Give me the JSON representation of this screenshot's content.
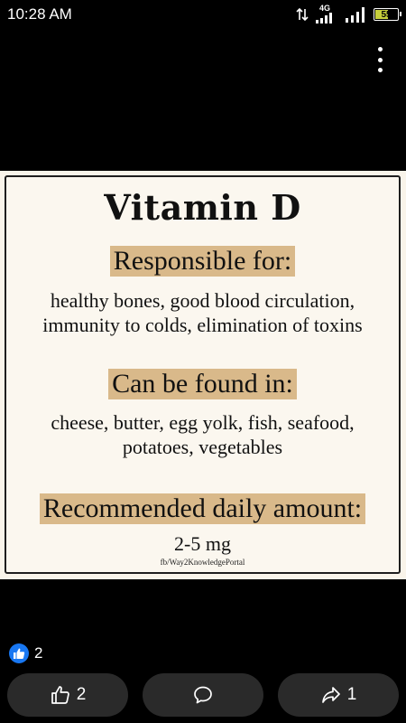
{
  "status_bar": {
    "time": "10:28 AM",
    "network": "4G",
    "battery": "55",
    "battery_level": 0.55
  },
  "poster": {
    "title": "Vitamin D",
    "sections": [
      {
        "heading": "Responsible for:",
        "text": "healthy bones, good blood circulation, immunity to colds, elimination of toxins"
      },
      {
        "heading": "Can be found in:",
        "text": "cheese, butter, egg yolk, fish, seafood, potatoes, vegetables"
      },
      {
        "heading": "Recommended daily amount:",
        "text": "2-5 mg"
      }
    ],
    "credit": "fb/Way2KnowledgePortal",
    "highlight_color": "#d9b98a"
  },
  "reactions": {
    "count": "2",
    "icon": "like-icon",
    "color": "#1877f2"
  },
  "actions": [
    {
      "icon": "thumbs-up-icon",
      "count": "2"
    },
    {
      "icon": "comment-icon",
      "count": ""
    },
    {
      "icon": "share-icon",
      "count": "1"
    }
  ]
}
